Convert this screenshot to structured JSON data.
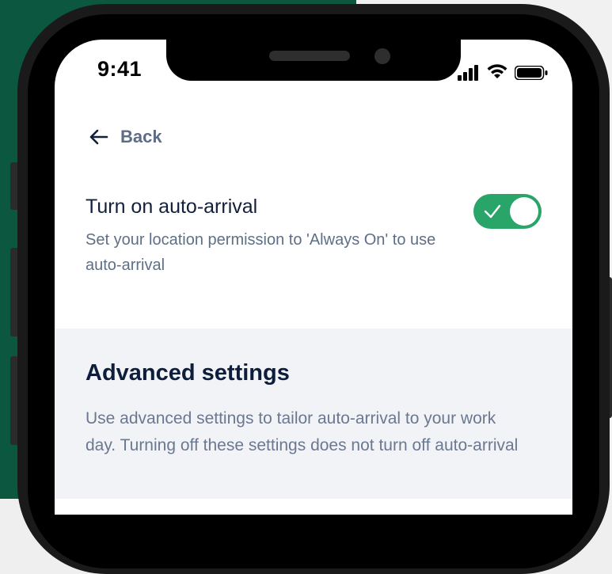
{
  "status_bar": {
    "time": "9:41",
    "icons": [
      "signal-icon",
      "wifi-icon",
      "battery-icon"
    ]
  },
  "nav": {
    "back_icon": "arrow-left-icon",
    "back_label": "Back"
  },
  "auto_arrival": {
    "title": "Turn on auto-arrival",
    "description": "Set your location permission to 'Always On' to use auto-arrival",
    "toggle_on": true,
    "toggle_color": "#2aa56a"
  },
  "advanced": {
    "title": "Advanced settings",
    "description": "Use advanced settings to tailor auto-arrival to your work day. Turning off these settings does not turn off auto-arrival"
  },
  "colors": {
    "brand_green_background": "#0b5740",
    "title_text": "#12203a",
    "secondary_text": "#5f6f86",
    "advanced_section_bg": "#f2f3f6"
  }
}
